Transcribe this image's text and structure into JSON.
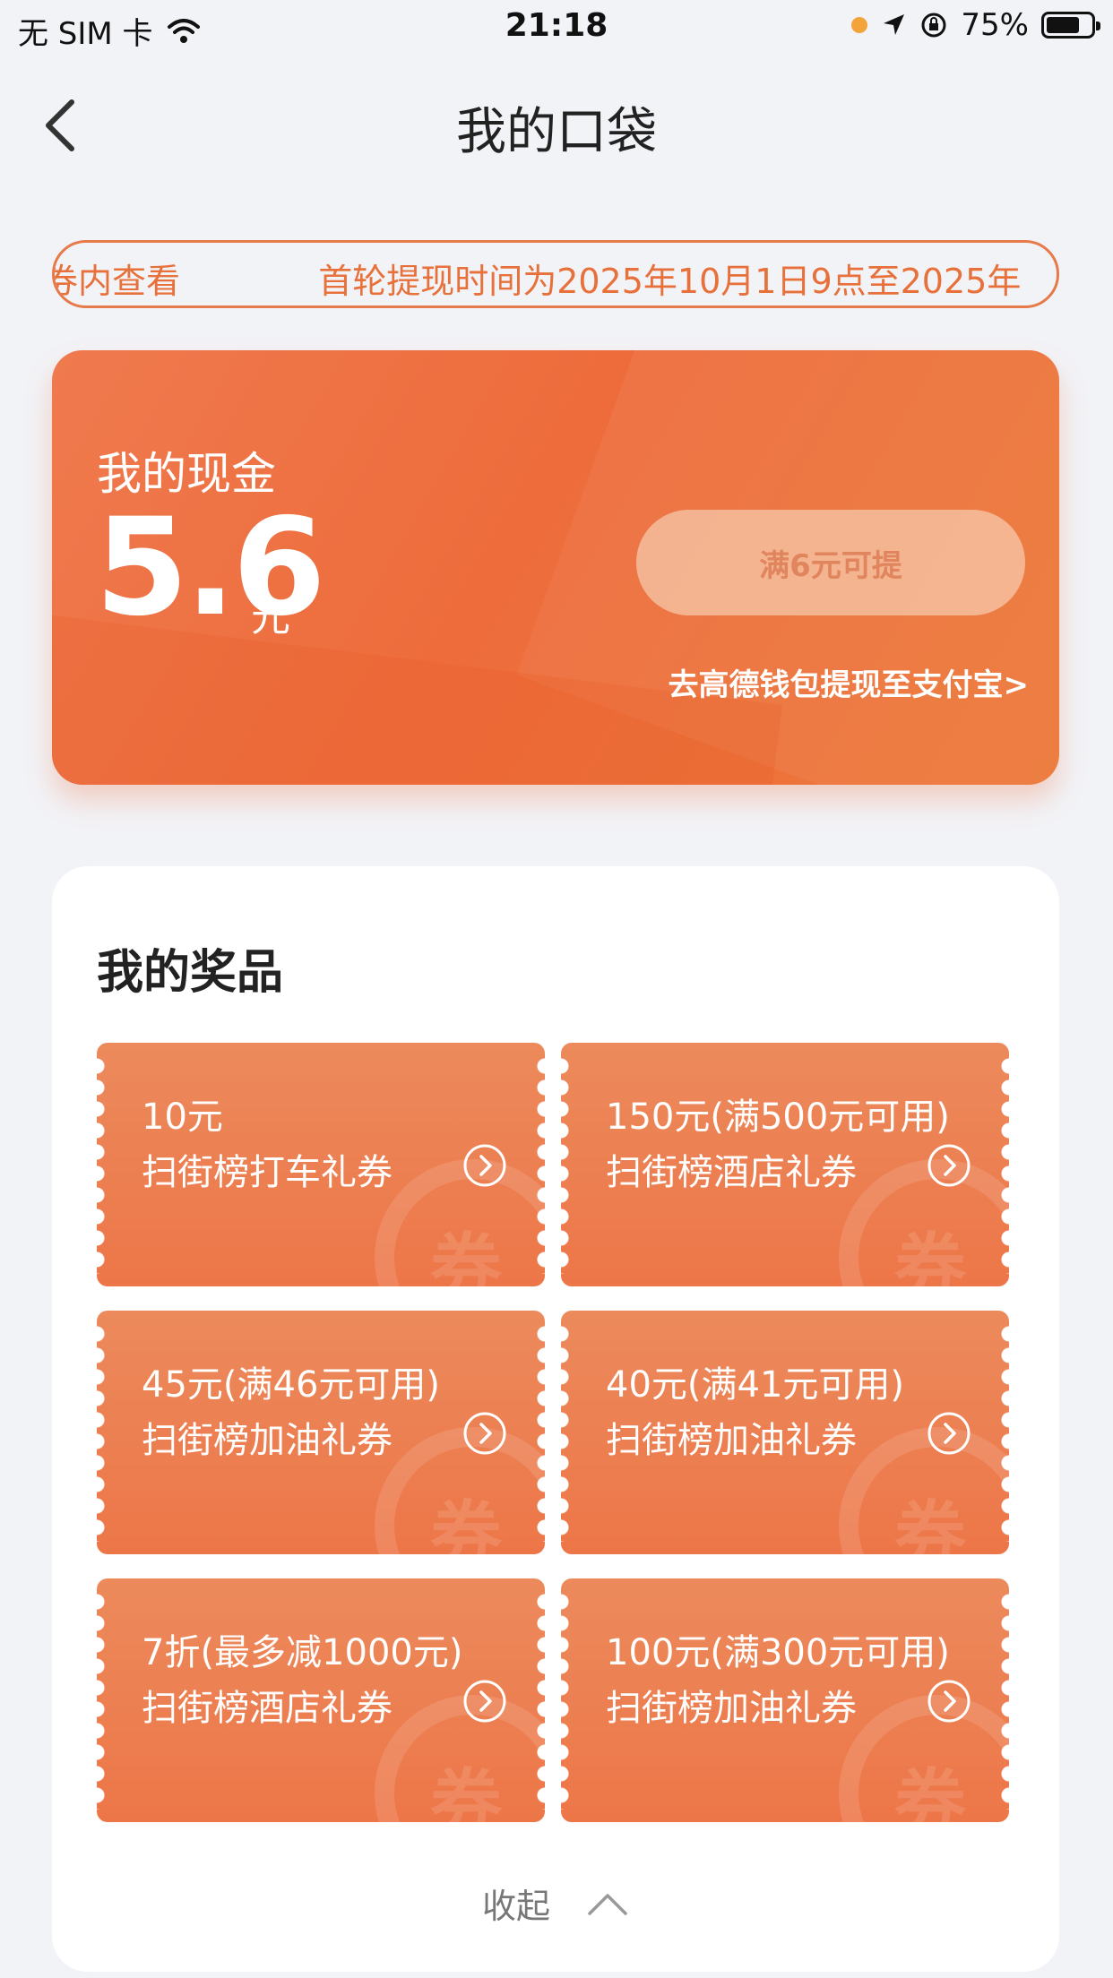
{
  "status_bar": {
    "carrier": "无 SIM 卡",
    "time": "21:18",
    "battery": "75%"
  },
  "nav": {
    "title": "我的口袋"
  },
  "notice": {
    "text_a": "券内查看",
    "text_b": "首轮提现时间为2025年10月1日9点至2025年"
  },
  "cash": {
    "label": "我的现金",
    "amount": "5.6",
    "unit": "元",
    "withdraw_button": "满6元可提",
    "withdraw_link": "去高德钱包提现至支付宝>"
  },
  "prizes": {
    "title": "我的奖品",
    "watermark": "券",
    "items": [
      {
        "amount": "10元",
        "name": "扫街榜打车礼券"
      },
      {
        "amount": "150元(满500元可用)",
        "name": "扫街榜酒店礼券"
      },
      {
        "amount": "45元(满46元可用)",
        "name": "扫街榜加油礼券"
      },
      {
        "amount": "40元(满41元可用)",
        "name": "扫街榜加油礼券"
      },
      {
        "amount": "7折(最多减1000元)",
        "name": "扫街榜酒店礼券"
      },
      {
        "amount": "100元(满300元可用)",
        "name": "扫街榜加油礼券"
      }
    ],
    "collapse_label": "收起"
  },
  "colors": {
    "accent": "#ee6c3c",
    "background": "#f2f3f7"
  }
}
